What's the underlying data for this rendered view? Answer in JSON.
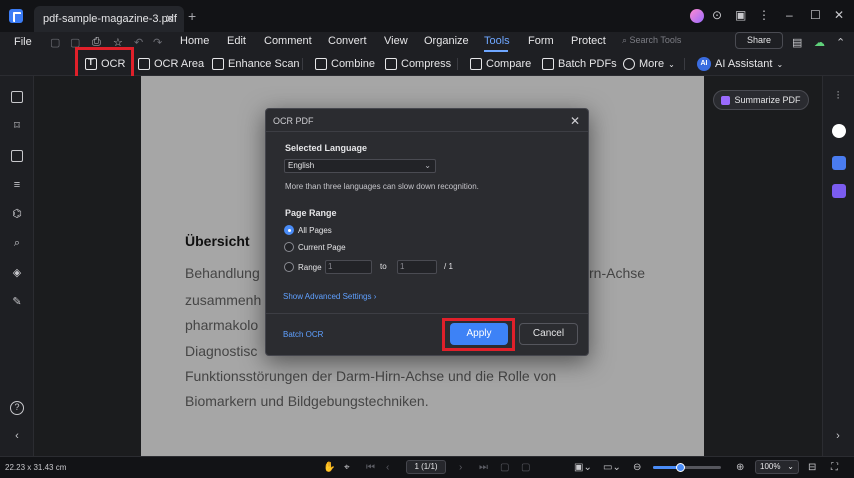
{
  "titlebar": {
    "tab_title": "pdf-sample-magazine-3.pdf",
    "tab_close": "✕",
    "new_tab": "+",
    "icons": [
      "avatar",
      "help-icon",
      "gift-icon",
      "dots-icon",
      "minimize-icon",
      "maximize-icon",
      "close-icon"
    ]
  },
  "menubar": {
    "file": "File",
    "items": [
      "Home",
      "Edit",
      "Comment",
      "Convert",
      "View",
      "Organize",
      "Tools",
      "Form",
      "Protect"
    ],
    "active": "Tools",
    "search_placeholder": "Search Tools",
    "share": "Share"
  },
  "toolbar": {
    "ocr": "OCR",
    "ocr_area": "OCR Area",
    "enhance_scan": "Enhance Scan",
    "combine": "Combine",
    "compress": "Compress",
    "compare": "Compare",
    "batch_pdfs": "Batch PDFs",
    "more": "More",
    "ai_badge": "AI",
    "ai_assistant": "AI Assistant"
  },
  "document": {
    "heading": "Übersicht",
    "lines": [
      "Behandlung",
      "zusammenh",
      "pharmakolo",
      "Diagnostisc",
      "Funktionsstörungen der Darm-Hirn-Achse und die Rolle von",
      "Biomarkern und Bildgebungstechniken."
    ],
    "line1_right": "rn-Achse"
  },
  "summarize": "Summarize PDF",
  "dialog": {
    "title": "OCR PDF",
    "selected_language_label": "Selected Language",
    "language_value": "English",
    "note": "More than three languages can slow down recognition.",
    "page_range_label": "Page Range",
    "options": [
      "All Pages",
      "Current Page",
      "Range"
    ],
    "selected_option": "All Pages",
    "range_from": "1",
    "range_to_label": "to",
    "range_to": "1",
    "range_total": "/ 1",
    "advanced_link": "Show Advanced Settings",
    "batch_ocr": "Batch OCR",
    "apply": "Apply",
    "cancel": "Cancel"
  },
  "statusbar": {
    "dimensions": "22.23 x 31.43 cm",
    "page_indicator": "1 (1/1)",
    "zoom": "100%",
    "zoom_fraction": 0.39
  },
  "colors": {
    "accent": "#3d82f6",
    "highlight": "#e0202a",
    "link": "#5fa0ff"
  }
}
